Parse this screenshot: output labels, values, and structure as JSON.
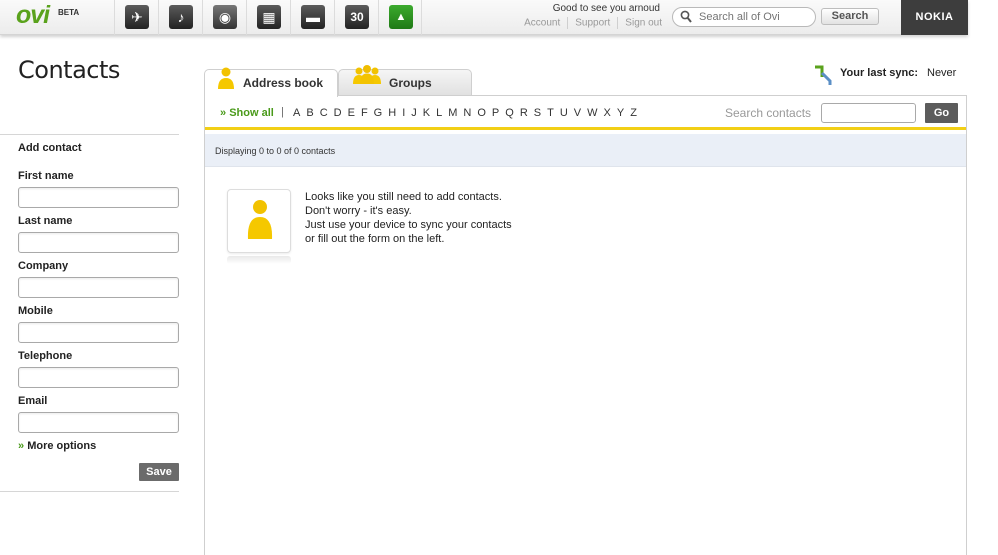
{
  "header": {
    "logo_text": "ovi",
    "logo_badge": "BETA",
    "apps": [
      {
        "name": "maps",
        "glyph": "✈"
      },
      {
        "name": "music",
        "glyph": "♪"
      },
      {
        "name": "photos",
        "glyph": "◉"
      },
      {
        "name": "contacts-grid",
        "glyph": "▦"
      },
      {
        "name": "files",
        "glyph": "▬"
      },
      {
        "name": "calendar",
        "glyph": "30"
      },
      {
        "name": "contacts",
        "glyph": "▲"
      }
    ],
    "greeting": "Good to see you arnoud",
    "links": [
      "Account",
      "Support",
      "Sign out"
    ],
    "search_placeholder": "Search all of Ovi",
    "search_button": "Search",
    "brand": "NOKIA"
  },
  "sidebar": {
    "title": "Contacts",
    "section_title": "Add contact",
    "fields": [
      {
        "label": "First name",
        "value": ""
      },
      {
        "label": "Last name",
        "value": ""
      },
      {
        "label": "Company",
        "value": ""
      },
      {
        "label": "Mobile",
        "value": ""
      },
      {
        "label": "Telephone",
        "value": ""
      },
      {
        "label": "Email",
        "value": ""
      }
    ],
    "more_options_arrow": "»",
    "more_options": "More options",
    "save_button": "Save"
  },
  "main": {
    "tabs": [
      {
        "label": "Address book",
        "active": true
      },
      {
        "label": "Groups",
        "active": false
      }
    ],
    "sync_label": "Your last sync:",
    "sync_value": "Never",
    "show_all_arrow": "»",
    "show_all": "Show all",
    "pipe": "|",
    "letters": [
      "A",
      "B",
      "C",
      "D",
      "E",
      "F",
      "G",
      "H",
      "I",
      "J",
      "K",
      "L",
      "M",
      "N",
      "O",
      "P",
      "Q",
      "R",
      "S",
      "T",
      "U",
      "V",
      "W",
      "X",
      "Y",
      "Z"
    ],
    "search_contacts_label": "Search contacts",
    "search_contacts_value": "",
    "go_button": "Go",
    "status": "Displaying 0 to 0 of 0 contacts",
    "empty_lines": [
      "Looks like you still need to add contacts.",
      "Don't worry - it's easy.",
      "Just use your device to sync your contacts",
      "or fill out the form on the left."
    ]
  },
  "colors": {
    "accent_green": "#4a9a1a",
    "accent_yellow": "#f2cf15",
    "status_bg": "#eaeff7",
    "button_dark": "#5c5c5c"
  }
}
